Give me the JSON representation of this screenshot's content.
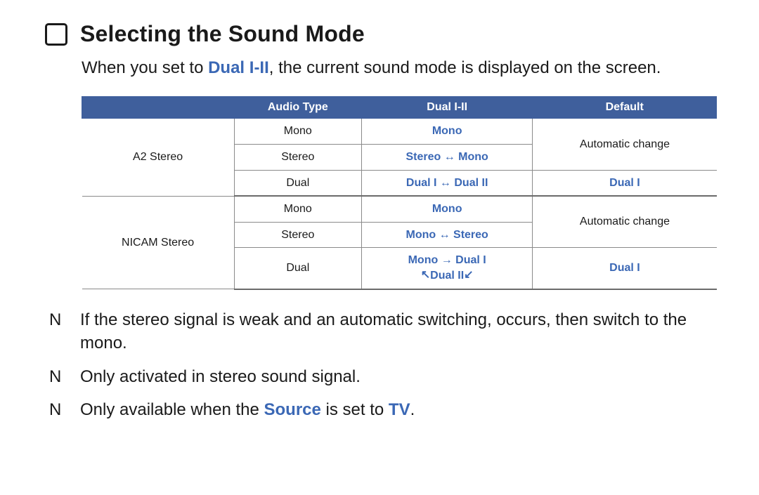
{
  "title": "Selecting the Sound Mode",
  "intro": {
    "prefix": "When you set to ",
    "dual": "Dual I-II",
    "suffix": ", the current sound mode is displayed on the screen."
  },
  "table": {
    "headers": {
      "blank": "",
      "audio_type": "Audio Type",
      "dual": "Dual I-II",
      "default": "Default"
    },
    "a2": {
      "label": "A2 Stereo",
      "r1": {
        "audio": "Mono",
        "dual": "Mono"
      },
      "r2": {
        "audio": "Stereo",
        "dual": "Stereo ↔ Mono"
      },
      "r3": {
        "audio": "Dual",
        "dual": "Dual I ↔ Dual II",
        "def": "Dual I"
      },
      "auto": "Automatic change"
    },
    "nicam": {
      "label": "NICAM Stereo",
      "r1": {
        "audio": "Mono",
        "dual": "Mono"
      },
      "r2": {
        "audio": "Stereo",
        "dual": "Mono ↔ Stereo"
      },
      "r3": {
        "audio": "Dual",
        "dual_line1": "Mono → Dual I",
        "dual_line2_pre": "↖ ",
        "dual_line2_mid": "Dual II",
        "dual_line2_post": " ↙",
        "def": "Dual I"
      },
      "auto": "Automatic change"
    }
  },
  "notes": {
    "marker": "N",
    "n1": "If the stereo signal is weak and an automatic switching, occurs, then switch to the mono.",
    "n2": "Only activated in stereo sound signal.",
    "n3": {
      "prefix": "Only available when the ",
      "source": "Source",
      "mid": " is set to ",
      "tv": "TV",
      "suffix": "."
    }
  }
}
